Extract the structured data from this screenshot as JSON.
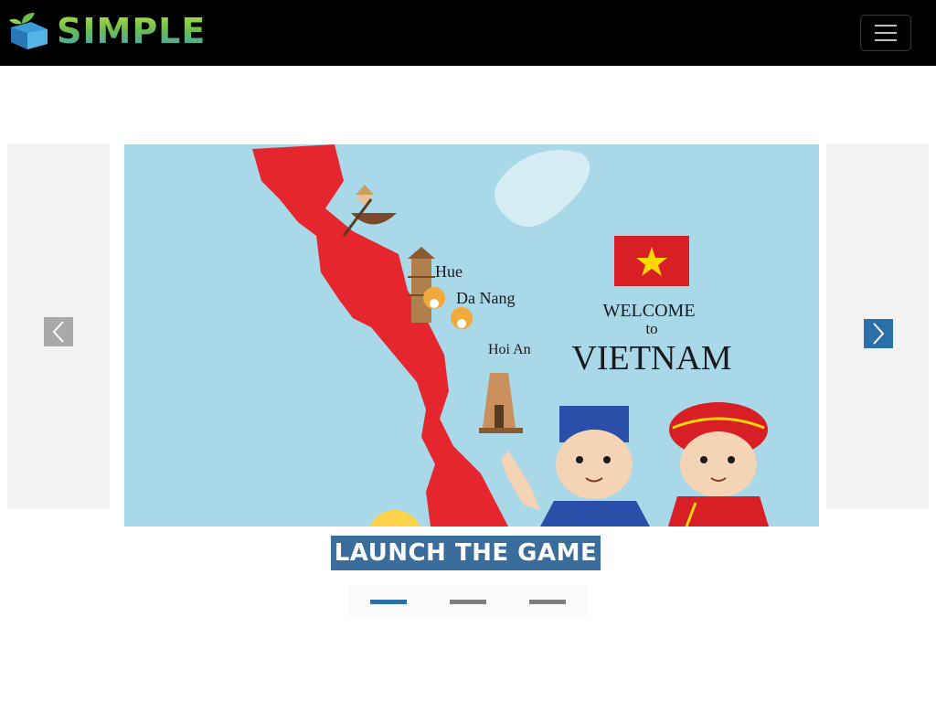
{
  "header": {
    "logo_text": "SIMPLE",
    "menu_icon": "hamburger-icon"
  },
  "carousel": {
    "prev_icon": "chevron-left-icon",
    "next_icon": "chevron-right-icon",
    "slide": {
      "map_labels": [
        "Hue",
        "Da Nang",
        "Hoi An"
      ],
      "welcome_line1": "WELCOME",
      "welcome_line2": "to",
      "welcome_line3": "VIETNAM"
    },
    "active_index": 0,
    "slide_count": 3
  },
  "launch_button": {
    "label": "LAUNCH THE GAME"
  },
  "colors": {
    "nav_bg": "#000000",
    "accent": "#2a6fa8",
    "launch_bg": "#3a6d9c",
    "map_red": "#e6262e",
    "sea": "#a9d8e8"
  }
}
